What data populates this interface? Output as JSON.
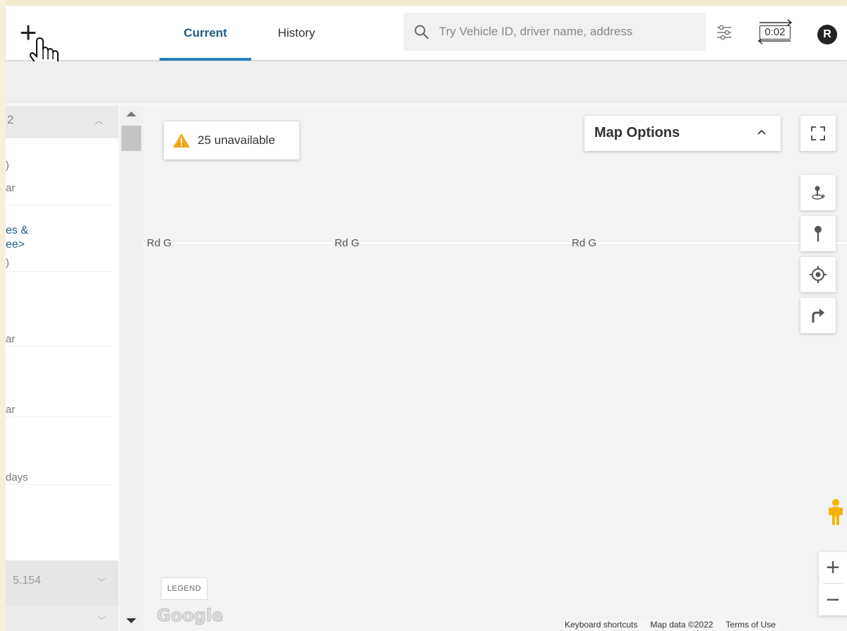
{
  "header": {
    "tabs": [
      {
        "label": "Current",
        "active": true
      },
      {
        "label": "History",
        "active": false
      }
    ],
    "search": {
      "placeholder": "Try Vehicle ID, driver name, address",
      "value": ""
    },
    "refresh_timer": "0:02",
    "avatar_initial": "R",
    "accent_color": "#2a7fc0"
  },
  "left_panel": {
    "header_text": "2",
    "lines": [
      {
        "text": ")",
        "style": "muted"
      },
      {
        "text": "ar",
        "style": "muted"
      },
      {
        "text": "es &",
        "style": "link"
      },
      {
        "text": "ee>",
        "style": "link"
      },
      {
        "text": ")",
        "style": "muted"
      },
      {
        "text": "ar",
        "style": "muted"
      },
      {
        "text": "ar",
        "style": "muted"
      },
      {
        "text": "days",
        "style": "muted"
      }
    ],
    "footer_text": "5.154"
  },
  "map": {
    "unavailable_label": "25 unavailable",
    "map_options_label": "Map Options",
    "road_labels": [
      "Rd G",
      "Rd G",
      "Rd G"
    ],
    "legend_label": "LEGEND",
    "google_logo": "Google",
    "attribution": {
      "shortcuts": "Keyboard shortcuts",
      "map_data": "Map data ©2022",
      "terms": "Terms of Use"
    },
    "zoom": {
      "in": "+",
      "out": "−"
    },
    "warning_color": "#f0a81a",
    "pegman_color": "#f5b400"
  }
}
